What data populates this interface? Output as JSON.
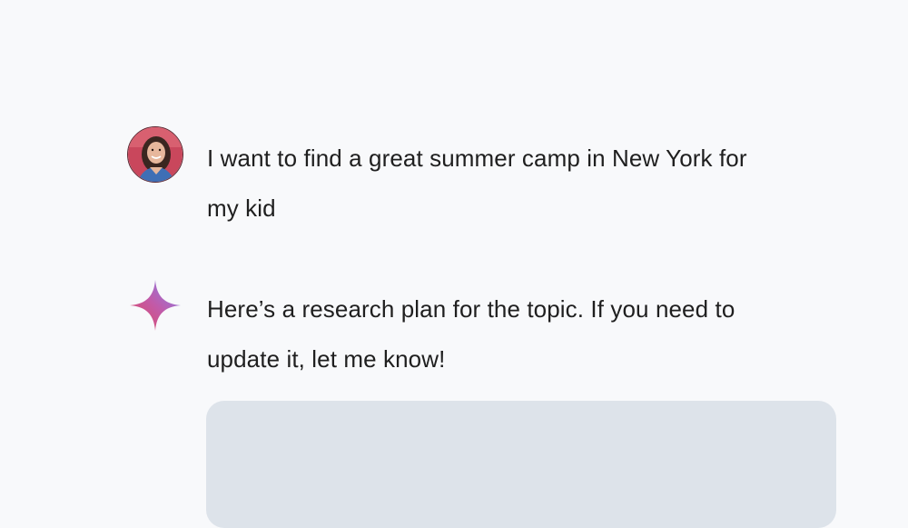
{
  "conversation": {
    "user": {
      "avatar_icon": "user-avatar-photo",
      "message": "I want to find a great summer camp in New York for my kid"
    },
    "model": {
      "icon": "gemini-spark-icon",
      "message": "Here’s a research plan for the topic. If you need to update it, let me know!"
    }
  },
  "colors": {
    "background": "#f8f9fb",
    "card": "#dde3ea",
    "text": "#1f1f1f",
    "spark_start": "#d9485f",
    "spark_end": "#8b7cf6"
  }
}
